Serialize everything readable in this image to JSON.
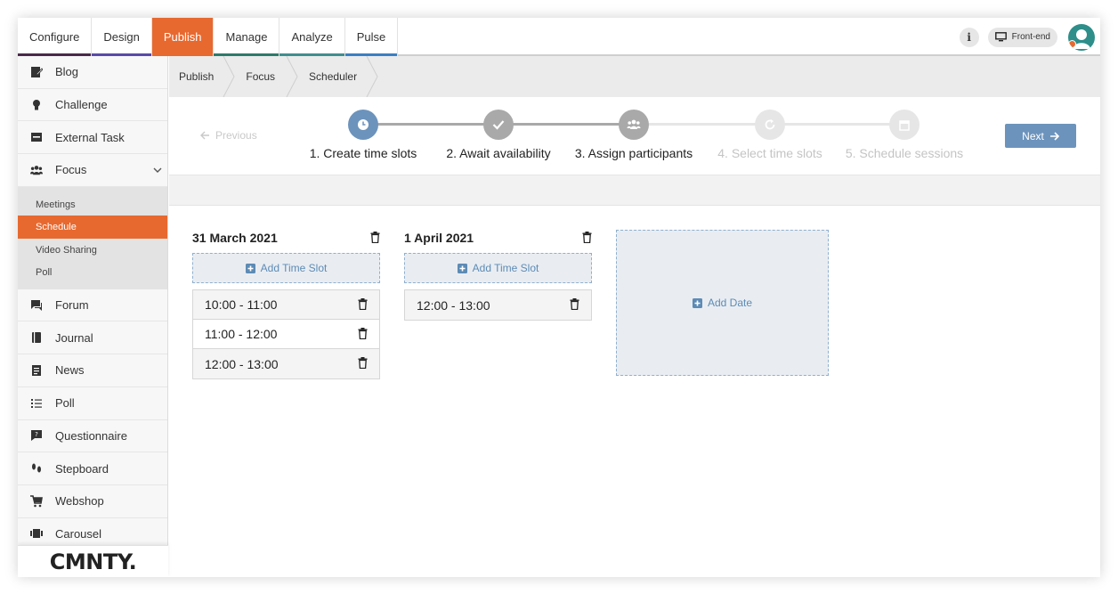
{
  "topnav": {
    "tabs": [
      {
        "label": "Configure",
        "bar": "#4a2a4a"
      },
      {
        "label": "Design",
        "bar": "#5a4aa8"
      },
      {
        "label": "Publish",
        "bar": "#e8692f",
        "active": true
      },
      {
        "label": "Manage",
        "bar": "#2e7a6a"
      },
      {
        "label": "Analyze",
        "bar": "#3f8f8f"
      },
      {
        "label": "Pulse",
        "bar": "#3a7fc2"
      }
    ],
    "info_label": "i",
    "frontend_label": "Front-end"
  },
  "sidebar": {
    "items_top": [
      {
        "label": "Blog",
        "icon": "blog-icon"
      },
      {
        "label": "Challenge",
        "icon": "lightbulb-icon"
      },
      {
        "label": "External Task",
        "icon": "external-task-icon"
      },
      {
        "label": "Focus",
        "icon": "group-icon"
      }
    ],
    "focus_sub": [
      {
        "label": "Meetings"
      },
      {
        "label": "Schedule",
        "active": true
      },
      {
        "label": "Video Sharing"
      },
      {
        "label": "Poll"
      }
    ],
    "items_bottom": [
      {
        "label": "Forum",
        "icon": "forum-icon"
      },
      {
        "label": "Journal",
        "icon": "journal-icon"
      },
      {
        "label": "News",
        "icon": "news-icon"
      },
      {
        "label": "Poll",
        "icon": "list-icon"
      },
      {
        "label": "Questionnaire",
        "icon": "questionnaire-icon"
      },
      {
        "label": "Stepboard",
        "icon": "footsteps-icon"
      },
      {
        "label": "Webshop",
        "icon": "cart-icon"
      },
      {
        "label": "Carousel",
        "icon": "carousel-icon"
      }
    ],
    "logo": "CMNTY."
  },
  "breadcrumb": [
    "Publish",
    "Focus",
    "Scheduler"
  ],
  "wizard": {
    "previous_label": "Previous",
    "next_label": "Next",
    "steps": [
      {
        "label": "1. Create time slots",
        "state": "current",
        "icon": "clock-icon"
      },
      {
        "label": "2. Await availability",
        "state": "done",
        "icon": "check-icon"
      },
      {
        "label": "3. Assign participants",
        "state": "done",
        "icon": "people-icon"
      },
      {
        "label": "4. Select time slots",
        "state": "disabled",
        "icon": "refresh-icon"
      },
      {
        "label": "5. Schedule sessions",
        "state": "disabled",
        "icon": "calendar-icon"
      }
    ]
  },
  "schedule": {
    "add_time_slot_label": "Add Time Slot",
    "add_date_label": "Add Date",
    "dates": [
      {
        "date": "31 March 2021",
        "slots": [
          "10:00 - 11:00",
          "11:00 - 12:00",
          "12:00 - 13:00"
        ]
      },
      {
        "date": "1 April 2021",
        "slots": [
          "12:00 - 13:00"
        ]
      }
    ]
  },
  "colors": {
    "accent": "#e8692f",
    "primary": "#6c93bc",
    "step_current": "#6c93bc",
    "step_done": "#a9a9a9",
    "step_disabled": "#e2e2e2"
  }
}
